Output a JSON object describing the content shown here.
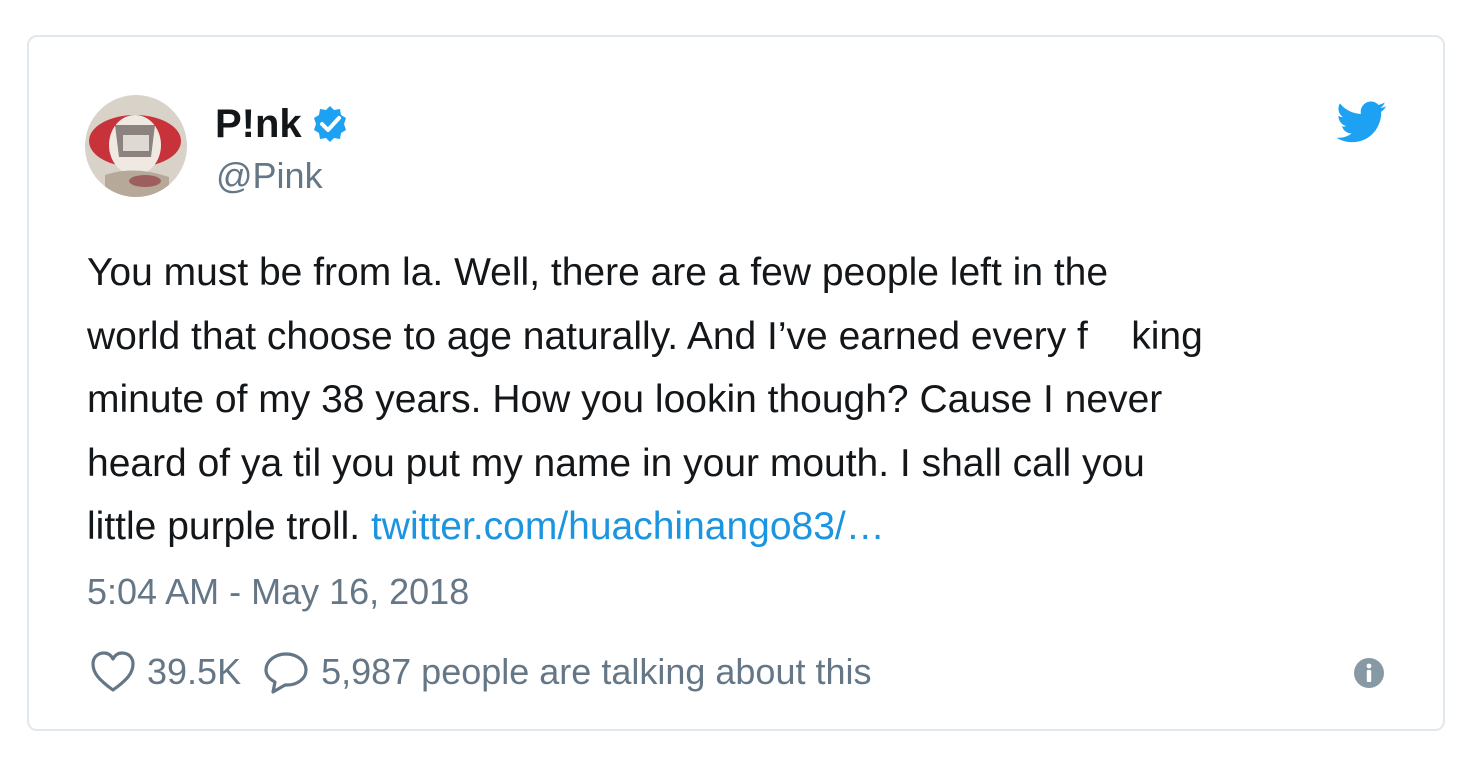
{
  "tweet": {
    "display_name": "P!nk",
    "handle": "@Pink",
    "text_lines": [
      "You must be from la. Well, there are a few people left in the",
      "world that choose to age naturally. And I’ve earned every f    king",
      "minute of my 38 years. How you lookin though? Cause I never",
      "heard of ya til you put my name in your mouth. I shall call you",
      "little purple troll. "
    ],
    "link_text": "twitter.com/huachinango83/…",
    "timestamp": "5:04 AM - May 16, 2018",
    "likes": "39.5K",
    "talking_count": "5,987",
    "talking_label": "people are talking about this"
  },
  "icons": {
    "verified": "verified-badge-icon",
    "brand": "twitter-bird-icon",
    "like": "heart-icon",
    "reply": "speech-bubble-icon",
    "info": "info-icon"
  },
  "colors": {
    "brand_blue": "#1da1f2",
    "link": "#1b95e0",
    "muted": "#657786",
    "text": "#14171a",
    "border": "#e1e8ed"
  }
}
